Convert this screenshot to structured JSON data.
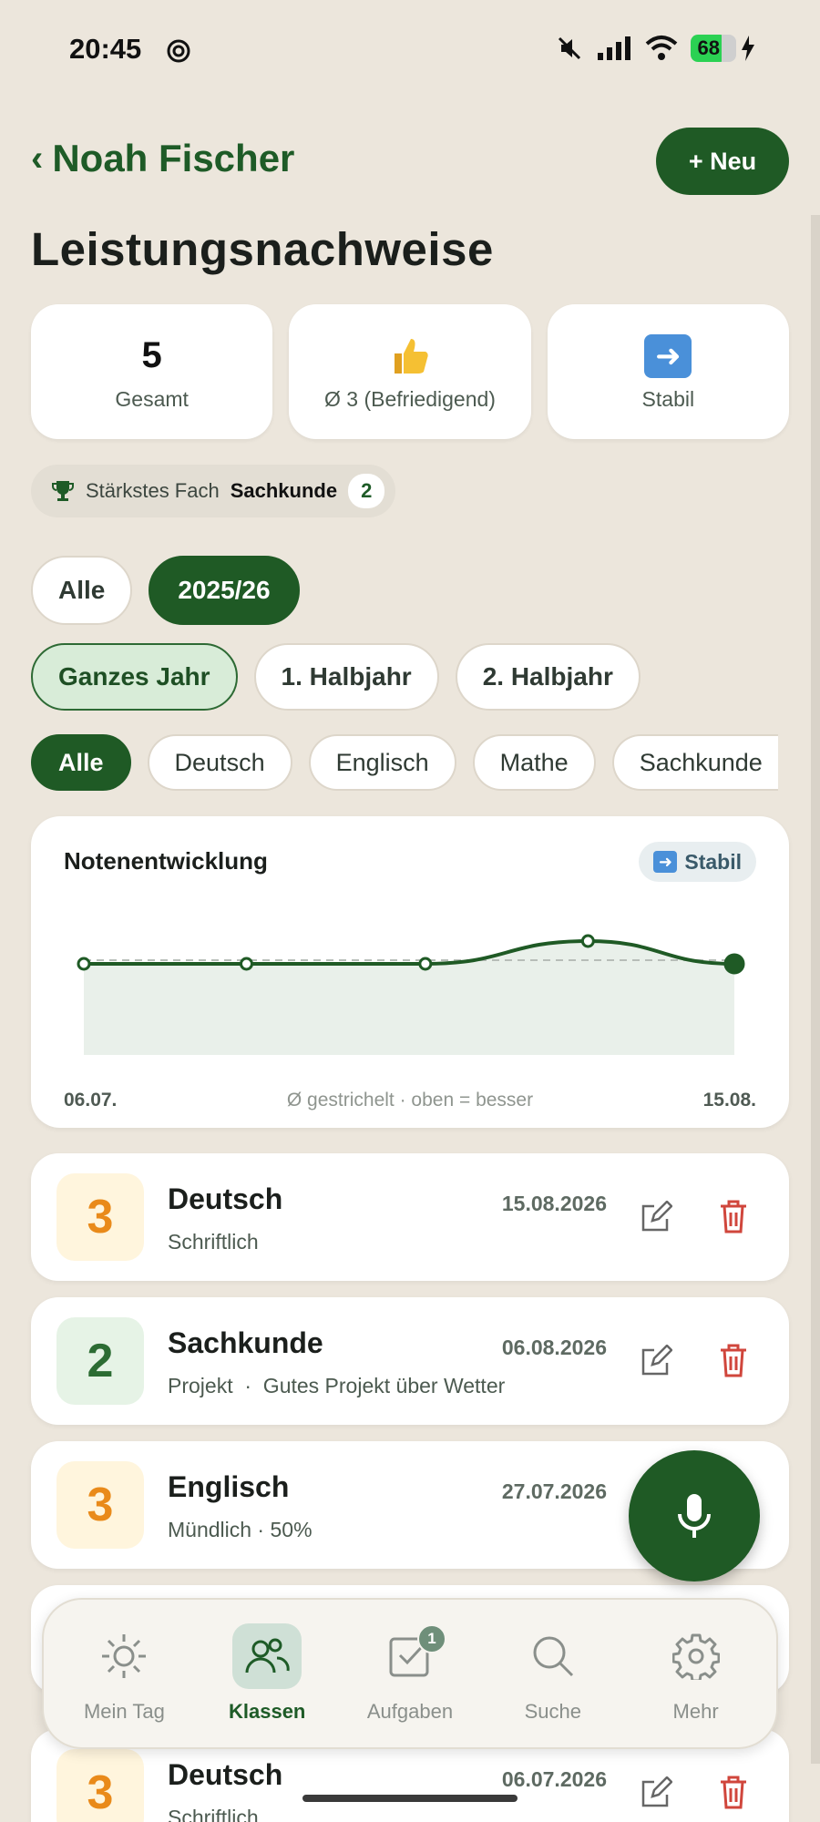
{
  "status": {
    "time": "20:45",
    "battery": "68"
  },
  "header": {
    "back_label": "Noah Fischer",
    "new_label": "+ Neu"
  },
  "page_title": "Leistungsnachweise",
  "stats": [
    {
      "value": "5",
      "label": "Gesamt"
    },
    {
      "icon": "thumbs-up",
      "label": "Ø 3 (Befriedigend)"
    },
    {
      "icon": "right-arrow",
      "label": "Stabil"
    }
  ],
  "strongest": {
    "prefix": "Stärkstes Fach",
    "subject": "Sachkunde",
    "count": "2"
  },
  "filters": {
    "years": [
      "Alle",
      "2025/26"
    ],
    "periods": [
      "Ganzes Jahr",
      "1. Halbjahr",
      "2. Halbjahr"
    ],
    "subjects": [
      "Alle",
      "Deutsch",
      "Englisch",
      "Mathe",
      "Sachkunde"
    ]
  },
  "chart": {
    "title": "Notenentwicklung",
    "badge": "Stabil",
    "start_label": "06.07.",
    "note": "Ø gestrichelt · oben = besser",
    "end_label": "15.08."
  },
  "chart_data": {
    "type": "line",
    "x": [
      "06.07.",
      "16.07.",
      "27.07.",
      "06.08.",
      "15.08."
    ],
    "series": [
      {
        "values": [
          3,
          3,
          3,
          2,
          3
        ]
      }
    ],
    "average": 3,
    "y_inverted": true,
    "ylim": [
      1,
      6
    ],
    "grid": false
  },
  "grades": [
    {
      "grade": "3",
      "subject": "Deutsch",
      "detail": "Schriftlich",
      "date": "15.08.2026",
      "tone": "g3"
    },
    {
      "grade": "2",
      "subject": "Sachkunde",
      "detail": "Projekt  ·  Gutes Projekt über Wetter",
      "date": "06.08.2026",
      "tone": "g2"
    },
    {
      "grade": "3",
      "subject": "Englisch",
      "detail": "Mündlich · 50%",
      "date": "27.07.2026",
      "tone": "g3"
    },
    {
      "grade": "3",
      "subject": "Deutsch",
      "detail": "Schriftlich",
      "date": "06.07.2026",
      "tone": "g3"
    }
  ],
  "nav": [
    {
      "label": "Mein Tag",
      "icon": "sun-icon"
    },
    {
      "label": "Klassen",
      "icon": "users-icon",
      "active": true
    },
    {
      "label": "Aufgaben",
      "icon": "checkbox-icon",
      "badge": "1"
    },
    {
      "label": "Suche",
      "icon": "search-icon"
    },
    {
      "label": "Mehr",
      "icon": "gear-icon"
    }
  ],
  "colors": {
    "accent": "#1f5a25",
    "background": "#ece6dc",
    "grade3": "#e98a1a",
    "grade2": "#2c6c33",
    "delete": "#d0463c"
  }
}
